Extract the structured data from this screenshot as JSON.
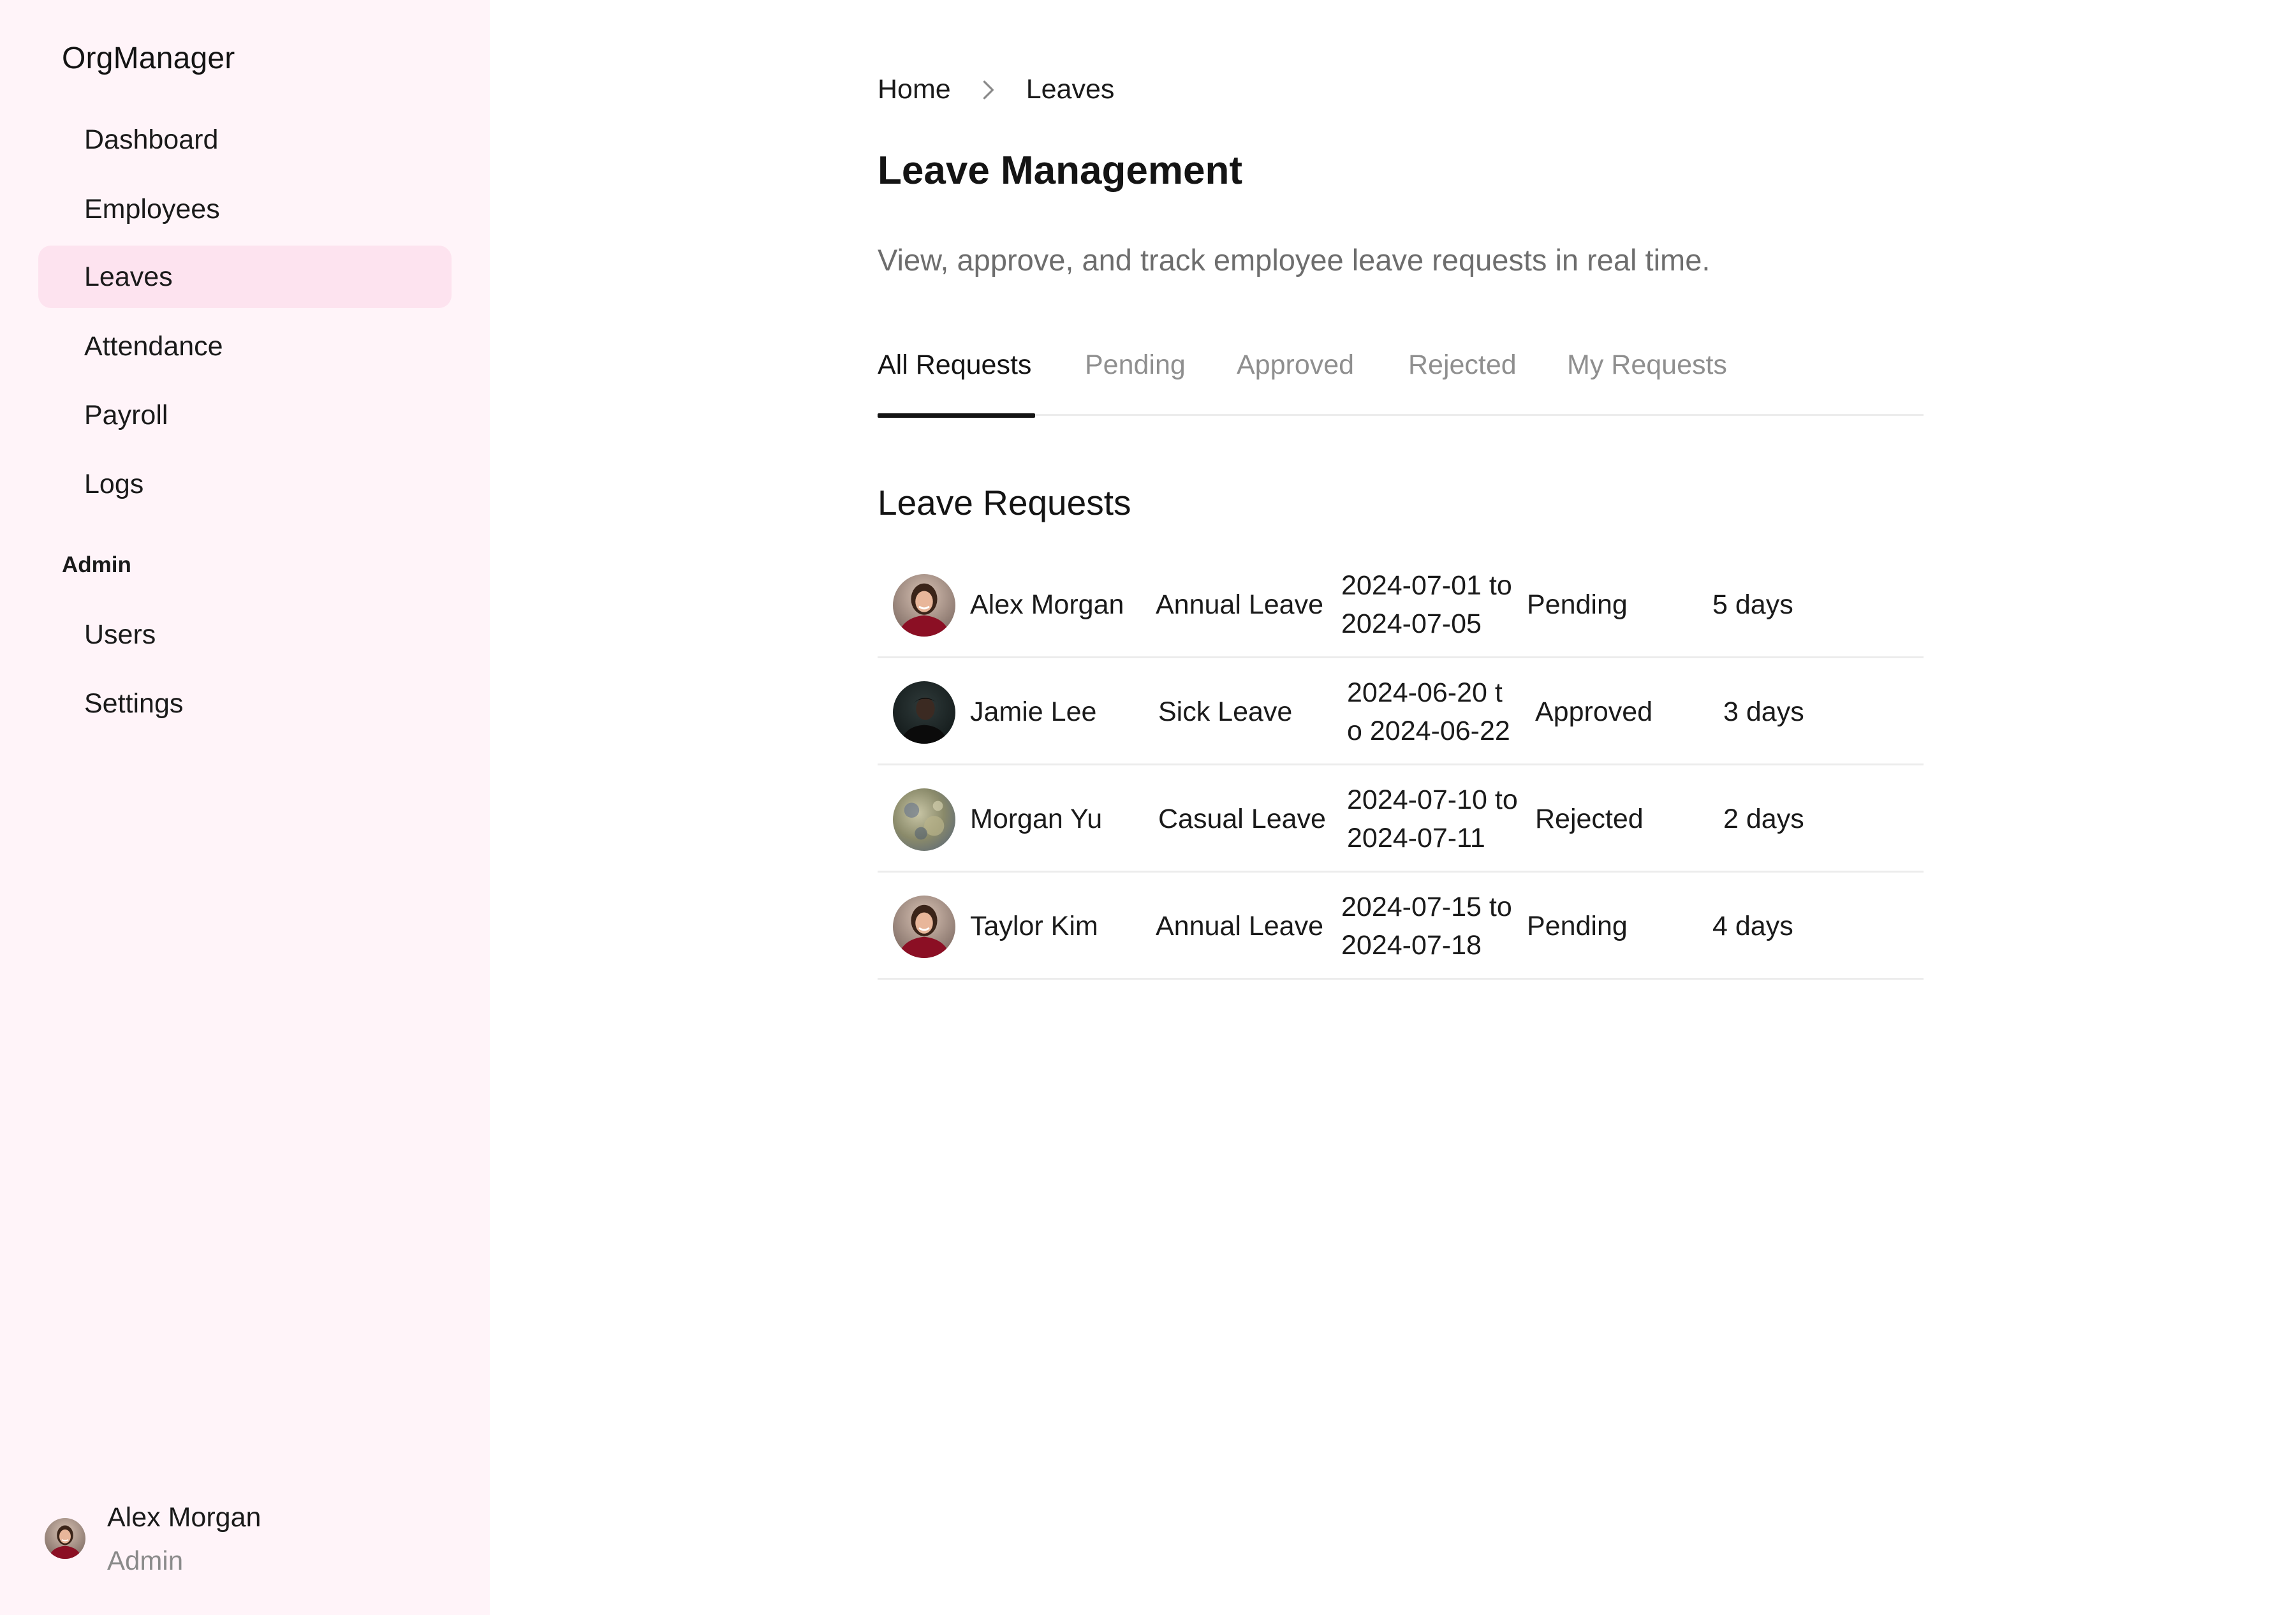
{
  "app": {
    "brand": "OrgManager"
  },
  "sidebar": {
    "items": [
      {
        "label": "Dashboard",
        "active": false
      },
      {
        "label": "Employees",
        "active": false
      },
      {
        "label": "Leaves",
        "active": true
      },
      {
        "label": "Attendance",
        "active": false
      },
      {
        "label": "Payroll",
        "active": false
      },
      {
        "label": "Logs",
        "active": false
      }
    ],
    "admin_label": "Admin",
    "admin_items": [
      {
        "label": "Users"
      },
      {
        "label": "Settings"
      }
    ],
    "user": {
      "name": "Alex Morgan",
      "role": "Admin"
    }
  },
  "breadcrumb": {
    "home": "Home",
    "current": "Leaves"
  },
  "page": {
    "title": "Leave Management",
    "subtitle": "View, approve, and track employee leave requests in real time."
  },
  "tabs": [
    {
      "label": "All Requests",
      "active": true
    },
    {
      "label": "Pending",
      "active": false
    },
    {
      "label": "Approved",
      "active": false
    },
    {
      "label": "Rejected",
      "active": false
    },
    {
      "label": "My Requests",
      "active": false
    }
  ],
  "requests": {
    "title": "Leave Requests",
    "rows": [
      {
        "name": "Alex Morgan",
        "type": "Annual Leave",
        "dates": "2024-07-01 to 2024-07-05",
        "status": "Pending",
        "duration": "5 days",
        "avatar": "woman-red-sweater"
      },
      {
        "name": "Jamie Lee",
        "type": "Sick Leave",
        "dates": "2024-06-20 to 2024-06-22",
        "status": "Approved",
        "duration": "3 days",
        "avatar": "man-dark-portrait"
      },
      {
        "name": "Morgan Yu",
        "type": "Casual Leave",
        "dates": "2024-07-10 to 2024-07-11",
        "status": "Rejected",
        "duration": "2 days",
        "avatar": "textured-abstract"
      },
      {
        "name": "Taylor Kim",
        "type": "Annual Leave",
        "dates": "2024-07-15 to 2024-07-18",
        "status": "Pending",
        "duration": "4 days",
        "avatar": "woman-red-sweater"
      }
    ]
  },
  "colors": {
    "sidebar_bg": "#fff4f9",
    "active_nav_bg": "#fde3ef",
    "muted_text": "#8f8f8f",
    "divider": "#ececec"
  }
}
